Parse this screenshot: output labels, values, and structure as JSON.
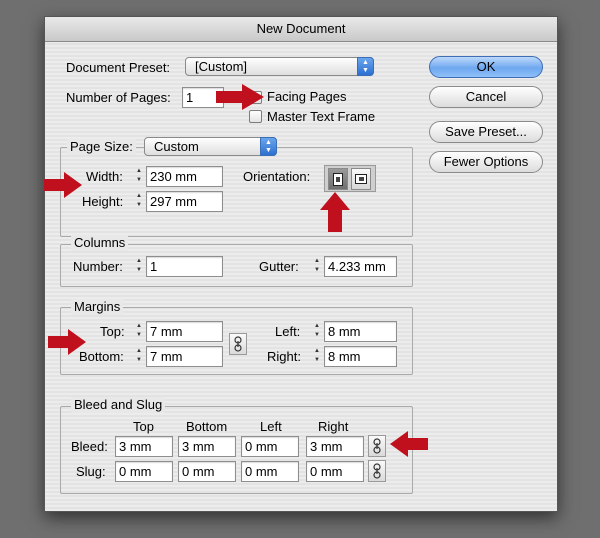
{
  "dialog": {
    "title": "New Document"
  },
  "preset": {
    "label": "Document Preset:",
    "value": "[Custom]"
  },
  "pages": {
    "label": "Number of Pages:",
    "value": "1",
    "facing_pages": "Facing Pages",
    "master_text_frame": "Master Text Frame"
  },
  "buttons": {
    "ok": "OK",
    "cancel": "Cancel",
    "save_preset": "Save Preset...",
    "fewer_options": "Fewer Options"
  },
  "page_size": {
    "label": "Page Size:",
    "value": "Custom",
    "width_label": "Width:",
    "width": "230 mm",
    "height_label": "Height:",
    "height": "297 mm",
    "orientation_label": "Orientation:"
  },
  "columns": {
    "title": "Columns",
    "number_label": "Number:",
    "number": "1",
    "gutter_label": "Gutter:",
    "gutter": "4.233 mm"
  },
  "margins": {
    "title": "Margins",
    "top_label": "Top:",
    "top": "7 mm",
    "bottom_label": "Bottom:",
    "bottom": "7 mm",
    "left_label": "Left:",
    "left": "8 mm",
    "right_label": "Right:",
    "right": "8 mm"
  },
  "bleed_slug": {
    "title": "Bleed and Slug",
    "col_top": "Top",
    "col_bottom": "Bottom",
    "col_left": "Left",
    "col_right": "Right",
    "bleed_label": "Bleed:",
    "bleed": [
      "3 mm",
      "3 mm",
      "0 mm",
      "3 mm"
    ],
    "slug_label": "Slug:",
    "slug": [
      "0 mm",
      "0 mm",
      "0 mm",
      "0 mm"
    ]
  },
  "colors": {
    "annotation_arrow": "#c0101e",
    "default_button": "#6fa8ef"
  },
  "icons": [
    "popup-arrows-icon",
    "stepper-icon",
    "portrait-orientation-icon",
    "landscape-orientation-icon",
    "chain-link-icon",
    "red-arrow-icon"
  ]
}
